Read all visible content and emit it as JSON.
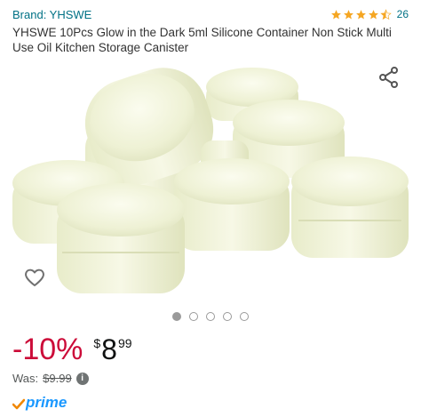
{
  "header": {
    "brand_label": "Brand: YHSWE",
    "rating": {
      "value": 4.5,
      "max": 5,
      "count": "26"
    }
  },
  "product": {
    "title": "YHSWE 10Pcs Glow in the Dark 5ml Silicone Container Non Stick Multi Use Oil Kitchen Storage Canister",
    "image_description_icon": "product-photo"
  },
  "gallery": {
    "total_images": 5,
    "active_index": 0
  },
  "pricing": {
    "discount": "-10%",
    "currency_symbol": "$",
    "price_whole": "8",
    "price_fraction": "99",
    "was_label": "Was:",
    "was_price": "$9.99",
    "info_icon": "i"
  },
  "badges": {
    "prime_label": "prime"
  },
  "colors": {
    "link": "#007185",
    "star": "#f5a623",
    "discount": "#cc0c39",
    "prime": "#1a98ff"
  },
  "icons": {
    "share": "share-icon",
    "wishlist": "heart-outline-icon"
  }
}
